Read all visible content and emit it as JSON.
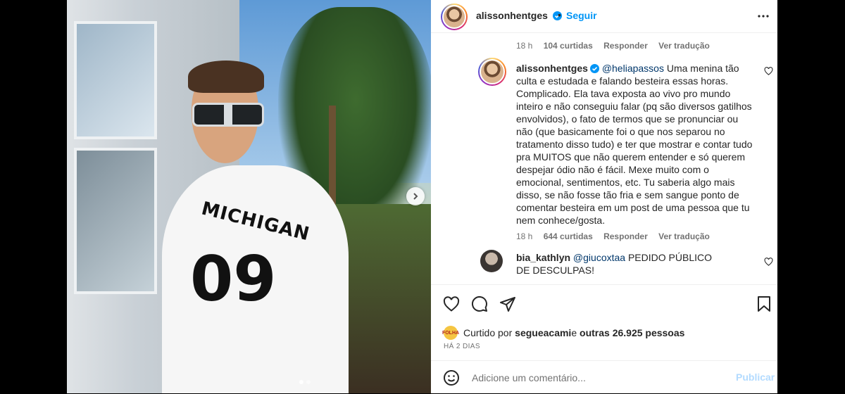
{
  "post": {
    "username": "alissonhentges",
    "follow_label": "Seguir",
    "photo_shirt_text": "MICHIGAN",
    "photo_shirt_number": "09"
  },
  "comments": [
    {
      "time": "18 h",
      "likes": "104 curtidas",
      "reply": "Responder",
      "translate": "Ver tradução"
    },
    {
      "username": "alissonhentges",
      "mention": "@heliapassos",
      "text": " Uma menina tão culta e estudada e falando besteira essas horas. Complicado. Ela tava exposta ao vivo pro mundo inteiro e não conseguiu falar (pq são diversos gatilhos envolvidos), o fato de termos que se pronunciar ou não (que basicamente foi o que nos separou no tratamento disso tudo) e ter que mostrar e contar tudo pra MUITOS que não querem entender e só querem despejar ódio não é fácil. Mexe muito com o emocional, sentimentos, etc. Tu saberia algo mais disso, se não fosse tão fria e sem sangue ponto de comentar besteira em um post de uma pessoa que tu nem conhece/gosta.",
      "time": "18 h",
      "likes": "644 curtidas",
      "reply": "Responder",
      "translate": "Ver tradução"
    },
    {
      "username": "bia_kathlyn",
      "mention": "@giucoxtaa",
      "text": " PEDIDO PÚBLICO DE DESCULPAS!"
    }
  ],
  "likes_line": {
    "prefix": "Curtido por ",
    "user": "segueacami",
    "middle": " e ",
    "others": "outras 26.925 pessoas",
    "badge": "FOLHA"
  },
  "date": "HÁ 2 DIAS",
  "add_comment": {
    "placeholder": "Adicione um comentário...",
    "post_label": "Publicar"
  },
  "colors": {
    "accent": "#0095f6",
    "verified": "#0095f6",
    "mention": "#00376b",
    "muted": "#737373"
  }
}
